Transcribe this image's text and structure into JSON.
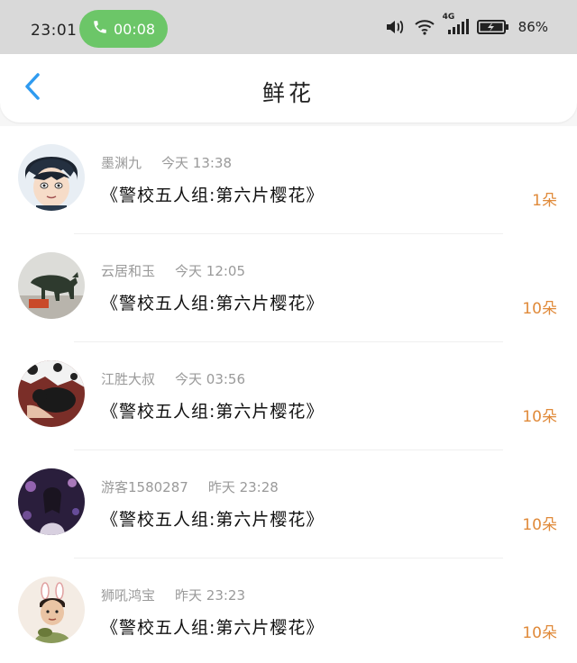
{
  "status_bar": {
    "time": "23:01",
    "call_timer": "00:08",
    "network": "4G",
    "battery": "86%"
  },
  "header": {
    "title": "鲜花"
  },
  "rows": [
    {
      "user": "墨渊九",
      "time": "今天 13:38",
      "work": "《警校五人组:第六片樱花》",
      "count": "1朵"
    },
    {
      "user": "云居和玉",
      "time": "今天 12:05",
      "work": "《警校五人组:第六片樱花》",
      "count": "10朵"
    },
    {
      "user": "江胜大叔",
      "time": "今天 03:56",
      "work": "《警校五人组:第六片樱花》",
      "count": "10朵"
    },
    {
      "user": "游客1580287",
      "time": "昨天 23:28",
      "work": "《警校五人组:第六片樱花》",
      "count": "10朵"
    },
    {
      "user": "狮吼鸿宝",
      "time": "昨天 23:23",
      "work": "《警校五人组:第六片樱花》",
      "count": "10朵"
    }
  ],
  "colors": {
    "call_green": "#6cc668",
    "accent_blue": "#2f9bf0",
    "count_orange": "#e08a3a"
  }
}
